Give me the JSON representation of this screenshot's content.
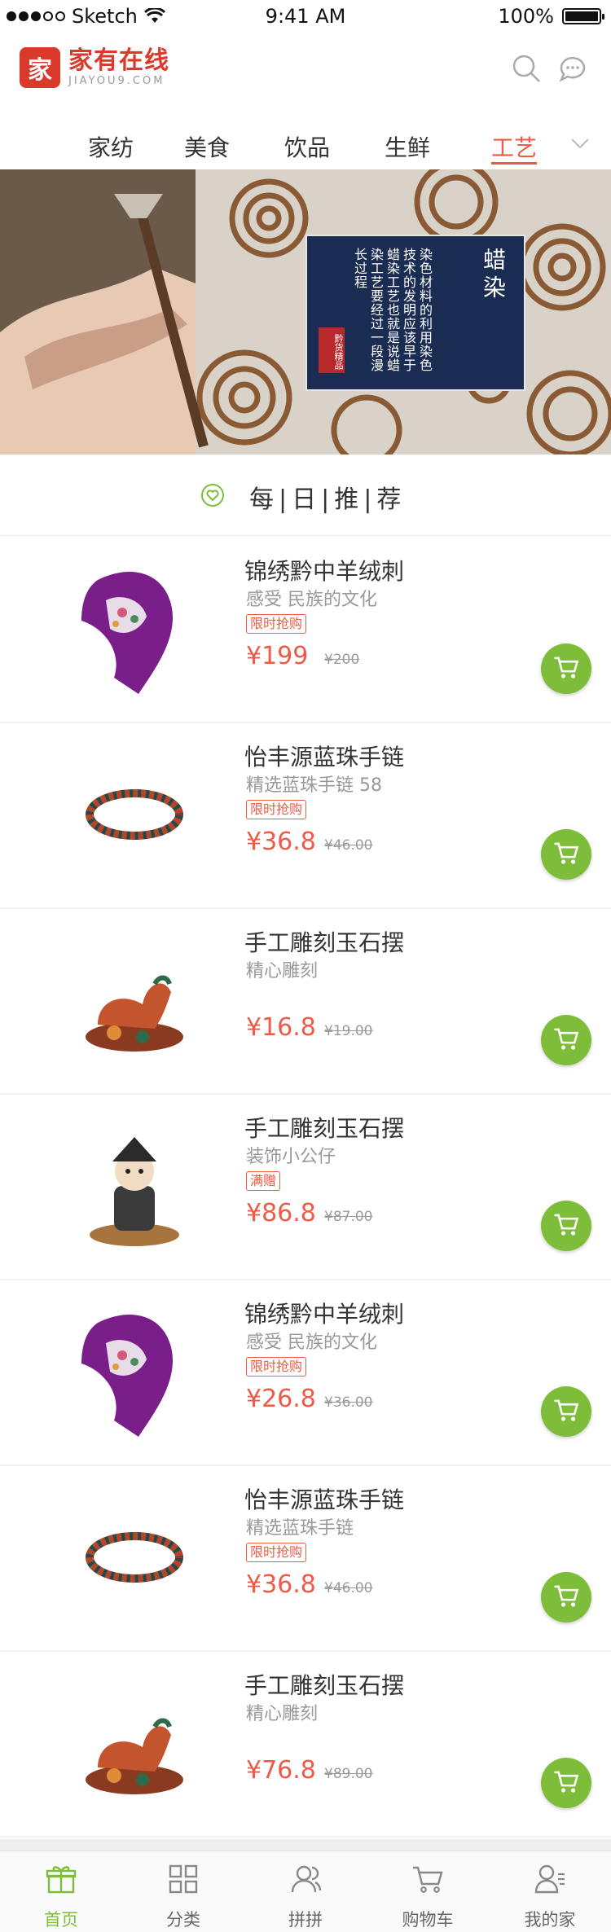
{
  "status_bar": {
    "carrier": "Sketch",
    "time": "9:41 AM",
    "battery": "100%"
  },
  "header": {
    "logo_mark": "家",
    "logo_cn": "家有在线",
    "logo_en": "JIAYOU9.COM"
  },
  "icons": {
    "search": "search-icon",
    "message": "message-icon",
    "chevron": "chevron-down-icon",
    "cart": "cart-icon",
    "heart": "heart-icon"
  },
  "tabs": [
    {
      "label": "家纺"
    },
    {
      "label": "美食"
    },
    {
      "label": "饮品"
    },
    {
      "label": "生鲜"
    },
    {
      "label": "工艺",
      "active": true
    }
  ],
  "banner": {
    "title": "蜡染",
    "text": "染色材料的利用染色技术的发明应该早于蜡染工艺也就是说蜡染工艺要经过一段漫长过程",
    "seal": "黔货精品"
  },
  "section": {
    "title": "每|日|推|荐"
  },
  "products": [
    {
      "name": "锦绣黔中羊绒刺",
      "subtitle": "感受 民族的文化",
      "tag": "限时抢购",
      "price": "¥199",
      "orig_price": "¥200",
      "kind": "scarf"
    },
    {
      "name": "怡丰源蓝珠手链",
      "subtitle": "精选蓝珠手链 58",
      "tag": "限时抢购",
      "price": "¥36.8",
      "orig_price": "¥46.00",
      "kind": "bracelet"
    },
    {
      "name": "手工雕刻玉石摆",
      "subtitle": "精心雕刻",
      "tag": "",
      "price": "¥16.8",
      "orig_price": "¥19.00",
      "kind": "rooster"
    },
    {
      "name": "手工雕刻玉石摆",
      "subtitle": "装饰小公仔",
      "tag": "满赠",
      "price": "¥86.8",
      "orig_price": "¥87.00",
      "kind": "doll"
    },
    {
      "name": "锦绣黔中羊绒刺",
      "subtitle": "感受 民族的文化",
      "tag": "限时抢购",
      "price": "¥26.8",
      "orig_price": "¥36.00",
      "kind": "scarf"
    },
    {
      "name": "怡丰源蓝珠手链",
      "subtitle": "精选蓝珠手链",
      "tag": "限时抢购",
      "price": "¥36.8",
      "orig_price": "¥46.00",
      "kind": "bracelet"
    },
    {
      "name": "手工雕刻玉石摆",
      "subtitle": "精心雕刻",
      "tag": "",
      "price": "¥76.8",
      "orig_price": "¥89.00",
      "kind": "rooster"
    }
  ],
  "tabbar": [
    {
      "label": "首页",
      "icon": "gift-icon",
      "active": true
    },
    {
      "label": "分类",
      "icon": "grid-icon"
    },
    {
      "label": "拼拼",
      "icon": "group-icon"
    },
    {
      "label": "购物车",
      "icon": "cart-icon"
    },
    {
      "label": "我的家",
      "icon": "profile-icon"
    }
  ],
  "colors": {
    "accent": "#ee5a46",
    "green": "#7dbd3a",
    "brand": "#d93a2b"
  }
}
